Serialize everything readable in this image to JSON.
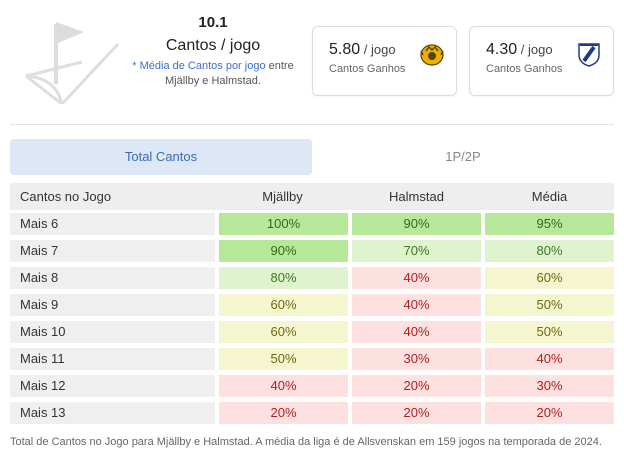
{
  "header": {
    "value": "10.1",
    "metric": "Cantos / jogo",
    "note_prefix": "* ",
    "note_highlight": "Média de Cantos por jogo",
    "note_suffix": " entre Mjällby e Halmstad."
  },
  "cards": [
    {
      "value": "5.80",
      "unit": " / jogo",
      "label": "Cantos Ganhos",
      "crest": "mjallby-crest-icon"
    },
    {
      "value": "4.30",
      "unit": " / jogo",
      "label": "Cantos Ganhos",
      "crest": "halmstad-crest-icon"
    }
  ],
  "tabs": [
    {
      "label": "Total Cantos",
      "active": true
    },
    {
      "label": "1P/2P",
      "active": false
    }
  ],
  "table": {
    "headers": [
      "Cantos no Jogo",
      "Mjällby",
      "Halmstad",
      "Média"
    ],
    "rows": [
      {
        "label": "Mais 6",
        "values": [
          "100%",
          "90%",
          "95%"
        ],
        "levels": [
          "g1",
          "g1",
          "g1"
        ]
      },
      {
        "label": "Mais 7",
        "values": [
          "90%",
          "70%",
          "80%"
        ],
        "levels": [
          "g1",
          "g2",
          "g2"
        ]
      },
      {
        "label": "Mais 8",
        "values": [
          "80%",
          "40%",
          "60%"
        ],
        "levels": [
          "g2",
          "r1",
          "y1"
        ]
      },
      {
        "label": "Mais 9",
        "values": [
          "60%",
          "40%",
          "50%"
        ],
        "levels": [
          "y1",
          "r1",
          "y1"
        ]
      },
      {
        "label": "Mais 10",
        "values": [
          "60%",
          "40%",
          "50%"
        ],
        "levels": [
          "y1",
          "r1",
          "y1"
        ]
      },
      {
        "label": "Mais 11",
        "values": [
          "50%",
          "30%",
          "40%"
        ],
        "levels": [
          "y1",
          "r1",
          "r1"
        ]
      },
      {
        "label": "Mais 12",
        "values": [
          "40%",
          "20%",
          "30%"
        ],
        "levels": [
          "r1",
          "r1",
          "r1"
        ]
      },
      {
        "label": "Mais 13",
        "values": [
          "20%",
          "20%",
          "20%"
        ],
        "levels": [
          "r1",
          "r1",
          "r1"
        ]
      }
    ]
  },
  "footnote": "Total de Cantos no Jogo para Mjällby e Halmstad. A média da liga é de Allsvenskan em 159 jogos na temporada de 2024.",
  "colors": {
    "accent": "#3b6bb5",
    "tab_active_bg": "#dde7f5",
    "high": "#b7e89a",
    "mid_high": "#dff3cf",
    "mid": "#f5f5cf",
    "low": "#fde0e0"
  }
}
